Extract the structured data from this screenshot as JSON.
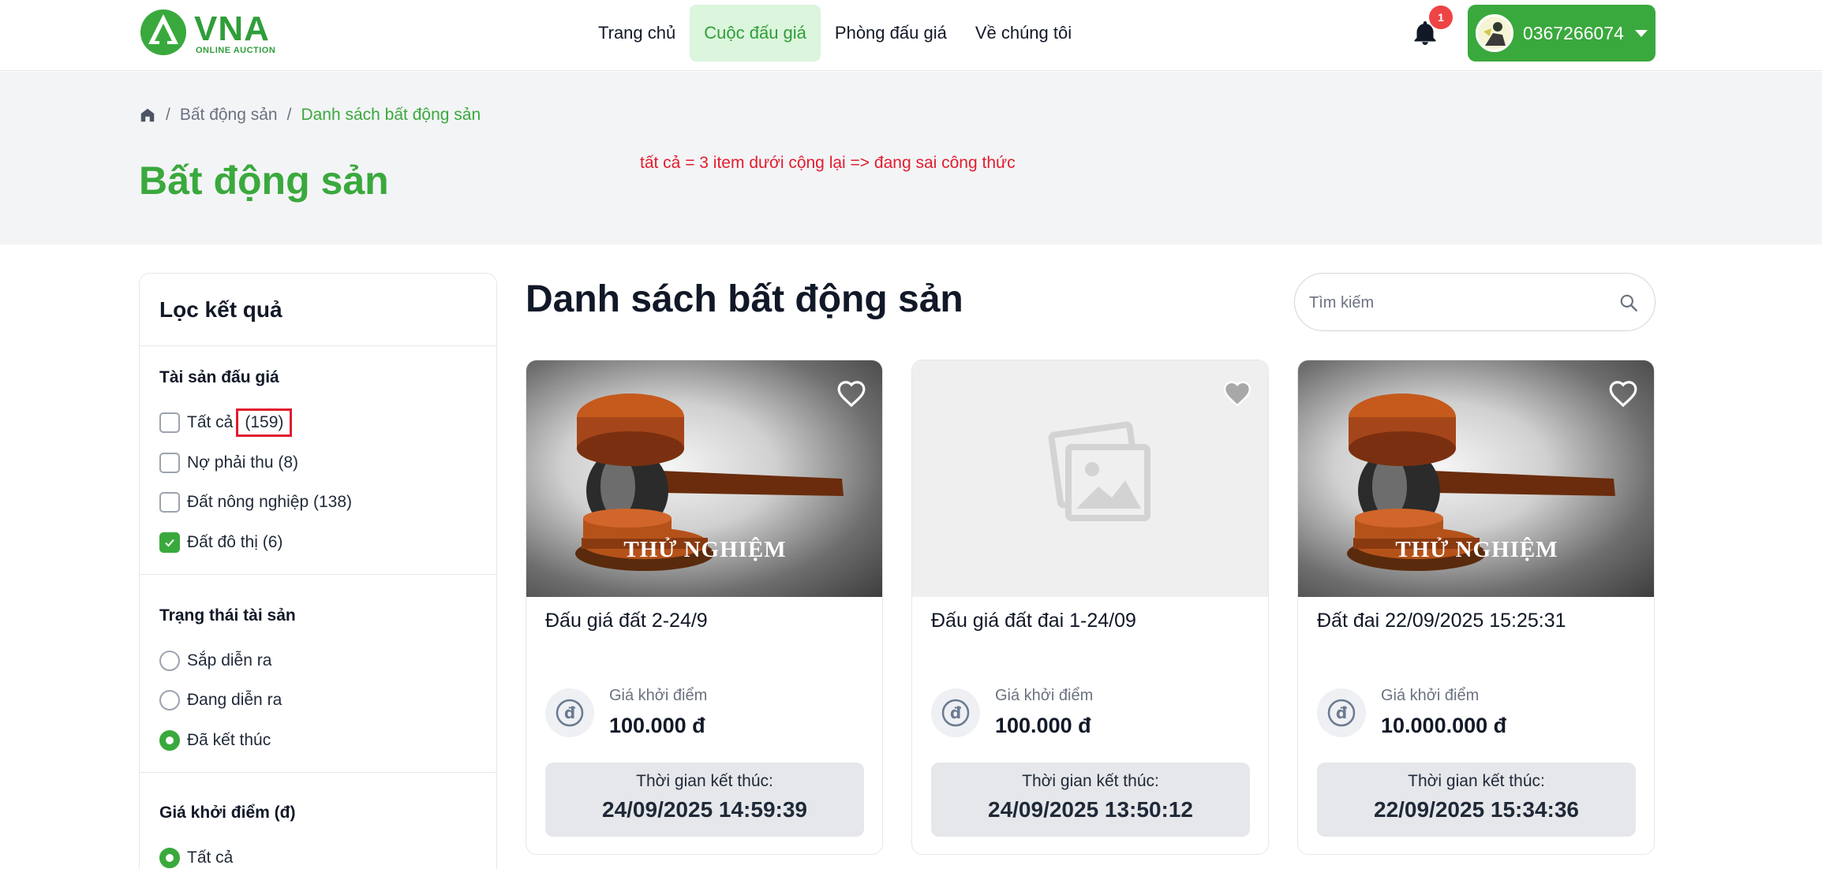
{
  "header": {
    "logo_text": "VNA",
    "logo_sub": "ONLINE AUCTION",
    "nav": [
      {
        "label": "Trang chủ",
        "active": false
      },
      {
        "label": "Cuộc đấu giá",
        "active": true
      },
      {
        "label": "Phòng đấu giá",
        "active": false
      },
      {
        "label": "Về chúng tôi",
        "active": false
      }
    ],
    "notification_count": "1",
    "user_phone": "0367266074"
  },
  "breadcrumb": {
    "items": [
      "Bất động sản",
      "Danh sách bất động sản"
    ]
  },
  "annotation": "tất cả = 3 item dưới cộng lại => đang sai công thức",
  "hero_title": "Bất động sản",
  "sidebar": {
    "title": "Lọc kết quả",
    "asset_section": "Tài sản đấu giá",
    "asset_options": [
      {
        "label": "Tất cả",
        "count": "(159)",
        "checked": false
      },
      {
        "label": "Nợ phải thu (8)",
        "checked": false
      },
      {
        "label": "Đất nông nghiệp (138)",
        "checked": false
      },
      {
        "label": "Đất đô thị (6)",
        "checked": true
      }
    ],
    "status_section": "Trạng thái tài sản",
    "status_options": [
      {
        "label": "Sắp diễn ra",
        "checked": false
      },
      {
        "label": "Đang diễn ra",
        "checked": false
      },
      {
        "label": "Đã kết thúc",
        "checked": true
      }
    ],
    "price_section": "Giá khởi điểm (đ)",
    "price_options": [
      {
        "label": "Tất cả",
        "checked": true
      }
    ]
  },
  "main": {
    "title": "Danh sách bất động sản",
    "search_placeholder": "Tìm kiếm"
  },
  "cards": [
    {
      "image": "gavel",
      "watermark": "THỬ NGHIỆM",
      "name": "Đấu giá đất 2-24/9",
      "price_label": "Giá khởi điểm",
      "price": "100.000 đ",
      "end_label": "Thời gian kết thúc:",
      "end_time": "24/09/2025 14:59:39"
    },
    {
      "image": "placeholder",
      "watermark": "",
      "name": "Đấu giá đất đai 1-24/09",
      "price_label": "Giá khởi điểm",
      "price": "100.000 đ",
      "end_label": "Thời gian kết thúc:",
      "end_time": "24/09/2025 13:50:12"
    },
    {
      "image": "gavel",
      "watermark": "THỬ NGHIỆM",
      "name": "Đất đai 22/09/2025 15:25:31",
      "price_label": "Giá khởi điểm",
      "price": "10.000.000 đ",
      "end_label": "Thời gian kết thúc:",
      "end_time": "22/09/2025 15:34:36"
    }
  ],
  "colors": {
    "brand_green": "#3aa93d",
    "annotation_red": "#e11d2e",
    "hero_bg": "#f3f4f6"
  }
}
